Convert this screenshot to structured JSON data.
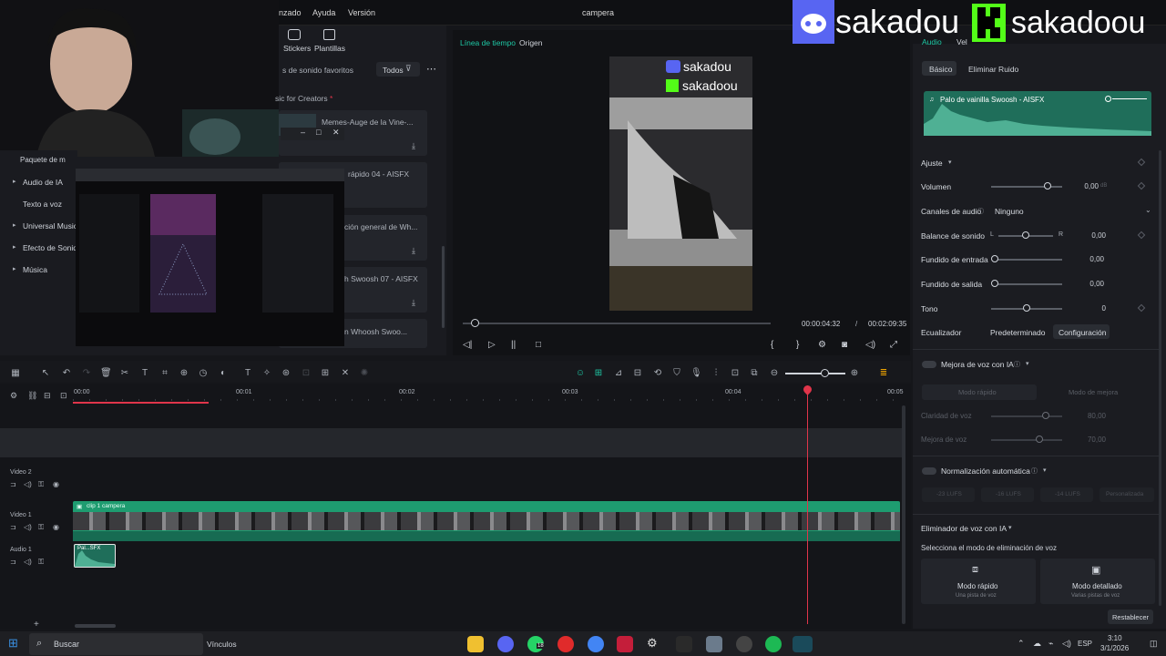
{
  "app": {
    "window_title": "campera",
    "menu": [
      "nzado",
      "Ayuda",
      "Versión"
    ]
  },
  "top_toolbar": {
    "stickers_label": "Stickers",
    "plantillas_label": "Plantillas",
    "todos_label": "Todos",
    "favorites_label": "s de sonido favoritos",
    "music_for_creators": "sic for Creators",
    "required_star": "*"
  },
  "sidebar": {
    "items": [
      {
        "label": "Paquete de m"
      },
      {
        "label": "Audio de IA"
      },
      {
        "label": "Texto a voz"
      },
      {
        "label": "Universal Music G"
      },
      {
        "label": "Efecto de Sonido"
      },
      {
        "label": "Música"
      }
    ]
  },
  "sound_list": {
    "items": [
      {
        "title": "Memes-Auge de la Vine-..."
      },
      {
        "title": "rápido 04 - AISFX"
      },
      {
        "title": "ción general de Wh..."
      },
      {
        "title": "h Swoosh 07 - AISFX"
      },
      {
        "title": "n Whoosh Swoo..."
      }
    ]
  },
  "preview": {
    "tab_timeline": "Línea de tiempo",
    "tab_origin": "Origen",
    "current_time": "00:00:04:32",
    "separator": "/",
    "total_time": "00:02:09:35",
    "overlay_discord": "sakadou",
    "overlay_kick": "sakadoou"
  },
  "stream_overlay": {
    "discord_name": "sakadou",
    "kick_name": "sakadoou"
  },
  "inspector": {
    "tab_audio": "Audio",
    "tab_velocidad": "Vel",
    "subtab_basic": "Básico",
    "subtab_noise": "Eliminar Ruido",
    "clip_name": "Palo de vainilla Swoosh - AISFX",
    "section_ajuste": "Ajuste",
    "volumen_label": "Volumen",
    "volumen_value": "0,00",
    "volumen_unit": "dB",
    "canales_label": "Canales de audio",
    "canales_value": "Ninguno",
    "balance_label": "Balance de sonido",
    "balance_l": "L",
    "balance_r": "R",
    "balance_value": "0,00",
    "fade_in_label": "Fundido de entrada",
    "fade_in_value": "0,00",
    "fade_out_label": "Fundido de salida",
    "fade_out_value": "0,00",
    "tono_label": "Tono",
    "tono_value": "0",
    "eq_label": "Ecualizador",
    "eq_value": "Predeterminado",
    "eq_config": "Configuración",
    "voice_enh_label": "Mejora de voz con IA",
    "mode_fast": "Modo rápido",
    "mode_improve": "Modo de mejora",
    "claridad_label": "Claridad de voz",
    "claridad_value": "80,00",
    "mejora_label": "Mejora de voz",
    "mejora_value": "70,00",
    "norm_label": "Normalización automática",
    "lufs": [
      "-23 LUFS",
      "-16 LUFS",
      "-14 LUFS",
      "Personalizada"
    ],
    "remover_label": "Eliminador de voz con IA",
    "remover_sub": "Selecciona el modo de eliminación de voz",
    "card_fast_title": "Modo rápido",
    "card_fast_sub": "Una pista de voz",
    "card_detail_title": "Modo detallado",
    "card_detail_sub": "Varias pistas de voz",
    "reset_label": "Restablecer"
  },
  "timeline": {
    "ruler": [
      "00:00",
      "00:01",
      "00:02",
      "00:03",
      "00:04",
      "00:05"
    ],
    "track_video2": "Video 2",
    "track_video1": "Video 1",
    "track_audio1": "Audio 1",
    "clip_label": "clip 1 campera",
    "audio_clip_label": "Pal...SFX"
  },
  "taskbar": {
    "search_placeholder": "Buscar",
    "links_label": "Vínculos",
    "lang": "ESP",
    "time": "3:10",
    "date": "3/1/2026",
    "badge": "18"
  },
  "colors": {
    "accent": "#1ec8a5",
    "clip_green": "#1e9c70",
    "playhead": "#e0354a"
  }
}
